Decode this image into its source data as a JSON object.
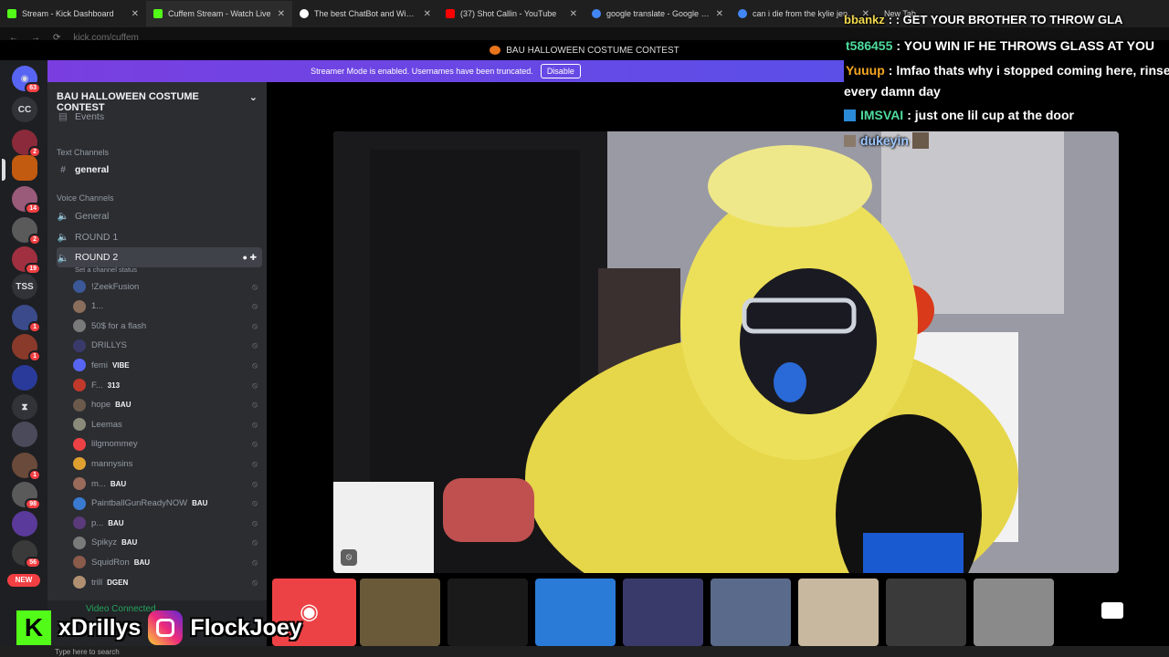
{
  "browser": {
    "tabs": [
      {
        "title": "Stream - Kick Dashboard",
        "color": "#53fc18"
      },
      {
        "title": "Cuffem Stream - Watch Live",
        "color": "#53fc18"
      },
      {
        "title": "The best ChatBot and Widgets",
        "color": "#ffffff"
      },
      {
        "title": "(37) Shot Callin - YouTube",
        "color": "#ff0000"
      },
      {
        "title": "google translate - Google Search",
        "color": "#4285f4"
      },
      {
        "title": "can i die from the kylie jenner",
        "color": "#4285f4"
      },
      {
        "title": "New Tab",
        "color": "#888888"
      }
    ],
    "url": "kick.com/cuffem"
  },
  "discord": {
    "window_title": "BAU HALLOWEEN COSTUME CONTEST",
    "banner_text": "Streamer Mode is enabled. Usernames have been truncated.",
    "banner_button": "Disable",
    "server_name": "BAU HALLOWEEN COSTUME CONTEST",
    "events_label": "Events",
    "text_channels_label": "Text Channels",
    "general_text": "general",
    "voice_channels_label": "Voice Channels",
    "voice_general": "General",
    "round1": "ROUND 1",
    "round2": "ROUND 2",
    "channel_status": "Set a channel status",
    "rail": [
      {
        "label": "",
        "badge": "63"
      },
      {
        "label": "CC",
        "badge": ""
      },
      {
        "label": "",
        "badge": "2"
      },
      {
        "label": "",
        "badge": ""
      },
      {
        "label": "",
        "badge": "14"
      },
      {
        "label": "",
        "badge": "2"
      },
      {
        "label": "",
        "badge": "19"
      },
      {
        "label": "TSS",
        "badge": ""
      },
      {
        "label": "",
        "badge": "1"
      },
      {
        "label": "",
        "badge": "1"
      },
      {
        "label": "",
        "badge": ""
      },
      {
        "label": "",
        "badge": ""
      },
      {
        "label": "",
        "badge": ""
      },
      {
        "label": "",
        "badge": "1"
      },
      {
        "label": "",
        "badge": "98"
      },
      {
        "label": "",
        "badge": ""
      },
      {
        "label": "",
        "badge": "56"
      }
    ],
    "rail_new": "NEW",
    "members": [
      {
        "name": "!ZeekFusion",
        "tag": "",
        "color": "#3b5998"
      },
      {
        "name": "1...",
        "tag": "",
        "color": "#8a6d5a"
      },
      {
        "name": "50$ for a flash",
        "tag": "",
        "color": "#7a7a7a"
      },
      {
        "name": "DRILLYS",
        "tag": "",
        "color": "#3a3a6a"
      },
      {
        "name": "femi",
        "tag": "VIBE",
        "color": "#5865f2"
      },
      {
        "name": "F...",
        "tag": "313",
        "color": "#c0392b"
      },
      {
        "name": "hope",
        "tag": "BAU",
        "color": "#6b5a4b"
      },
      {
        "name": "Leemas",
        "tag": "",
        "color": "#8a8a7a"
      },
      {
        "name": "lilgmommey",
        "tag": "",
        "color": "#ed4245"
      },
      {
        "name": "mannysins",
        "tag": "",
        "color": "#e0a030"
      },
      {
        "name": "m...",
        "tag": "BAU",
        "color": "#9a6a5a"
      },
      {
        "name": "PaintballGunReadyNOW",
        "tag": "BAU",
        "color": "#3a7ad0"
      },
      {
        "name": "p...",
        "tag": "BAU",
        "color": "#5a3a7a"
      },
      {
        "name": "Spikyz",
        "tag": "BAU",
        "color": "#7a7a7a"
      },
      {
        "name": "SquidRon",
        "tag": "BAU",
        "color": "#8a5a4a"
      },
      {
        "name": "trill",
        "tag": "DGEN",
        "color": "#b09070"
      }
    ],
    "voice_connected": "Video Connected"
  },
  "chat": [
    {
      "user": "bbankz",
      "msg": ": : GET YOUR BROTHER TO THROW GLA",
      "color": "#f2d94e"
    },
    {
      "user": "t586455",
      "msg": ": YOU WIN IF HE THROWS GLASS AT YOU",
      "color": "#4edb9c"
    },
    {
      "user": "Yuuup",
      "msg": ": lmfao thats why i stopped coming here, rinse",
      "color": "#f5a623"
    },
    {
      "user": "",
      "msg": "every damn day",
      "color": "#ffffff"
    },
    {
      "user": "IMSVAI",
      "msg": ": just one lil cup at the door",
      "color": "#4edb9c"
    },
    {
      "user": "dukeyin",
      "msg": "",
      "color": "#9ec7ff"
    }
  ],
  "overlay": {
    "kick_letter": "K",
    "kick_name": "xDrillys",
    "ig_name": "FlockJoey"
  },
  "taskbar": {
    "search": "Type here to search"
  }
}
